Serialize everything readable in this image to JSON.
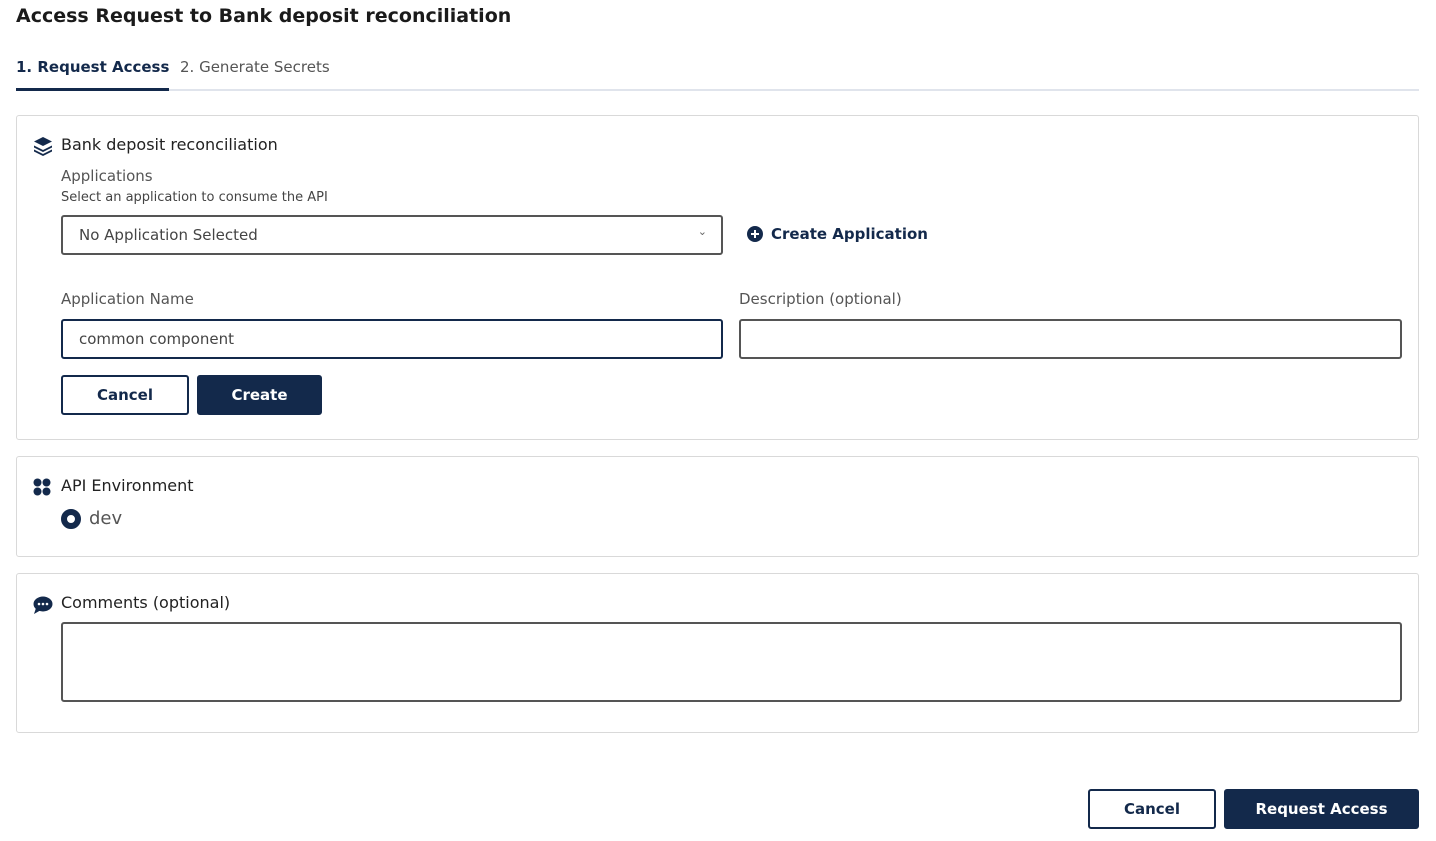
{
  "page_title": "Access Request to Bank deposit reconciliation",
  "tabs": [
    "1. Request Access",
    "2. Generate Secrets"
  ],
  "api_card": {
    "title": "Bank deposit reconciliation",
    "applications_label": "Applications",
    "applications_help": "Select an application to consume the API",
    "select_value": "No Application Selected",
    "create_application": "Create Application",
    "app_name_label": "Application Name",
    "app_name_value": "common component",
    "description_label": "Description (optional)",
    "description_value": "",
    "cancel": "Cancel",
    "create": "Create"
  },
  "env_card": {
    "title": "API Environment",
    "option": "dev"
  },
  "comments_card": {
    "title": "Comments (optional)",
    "value": ""
  },
  "footer": {
    "cancel": "Cancel",
    "request": "Request Access"
  },
  "colors": {
    "primary": "#13294b"
  }
}
